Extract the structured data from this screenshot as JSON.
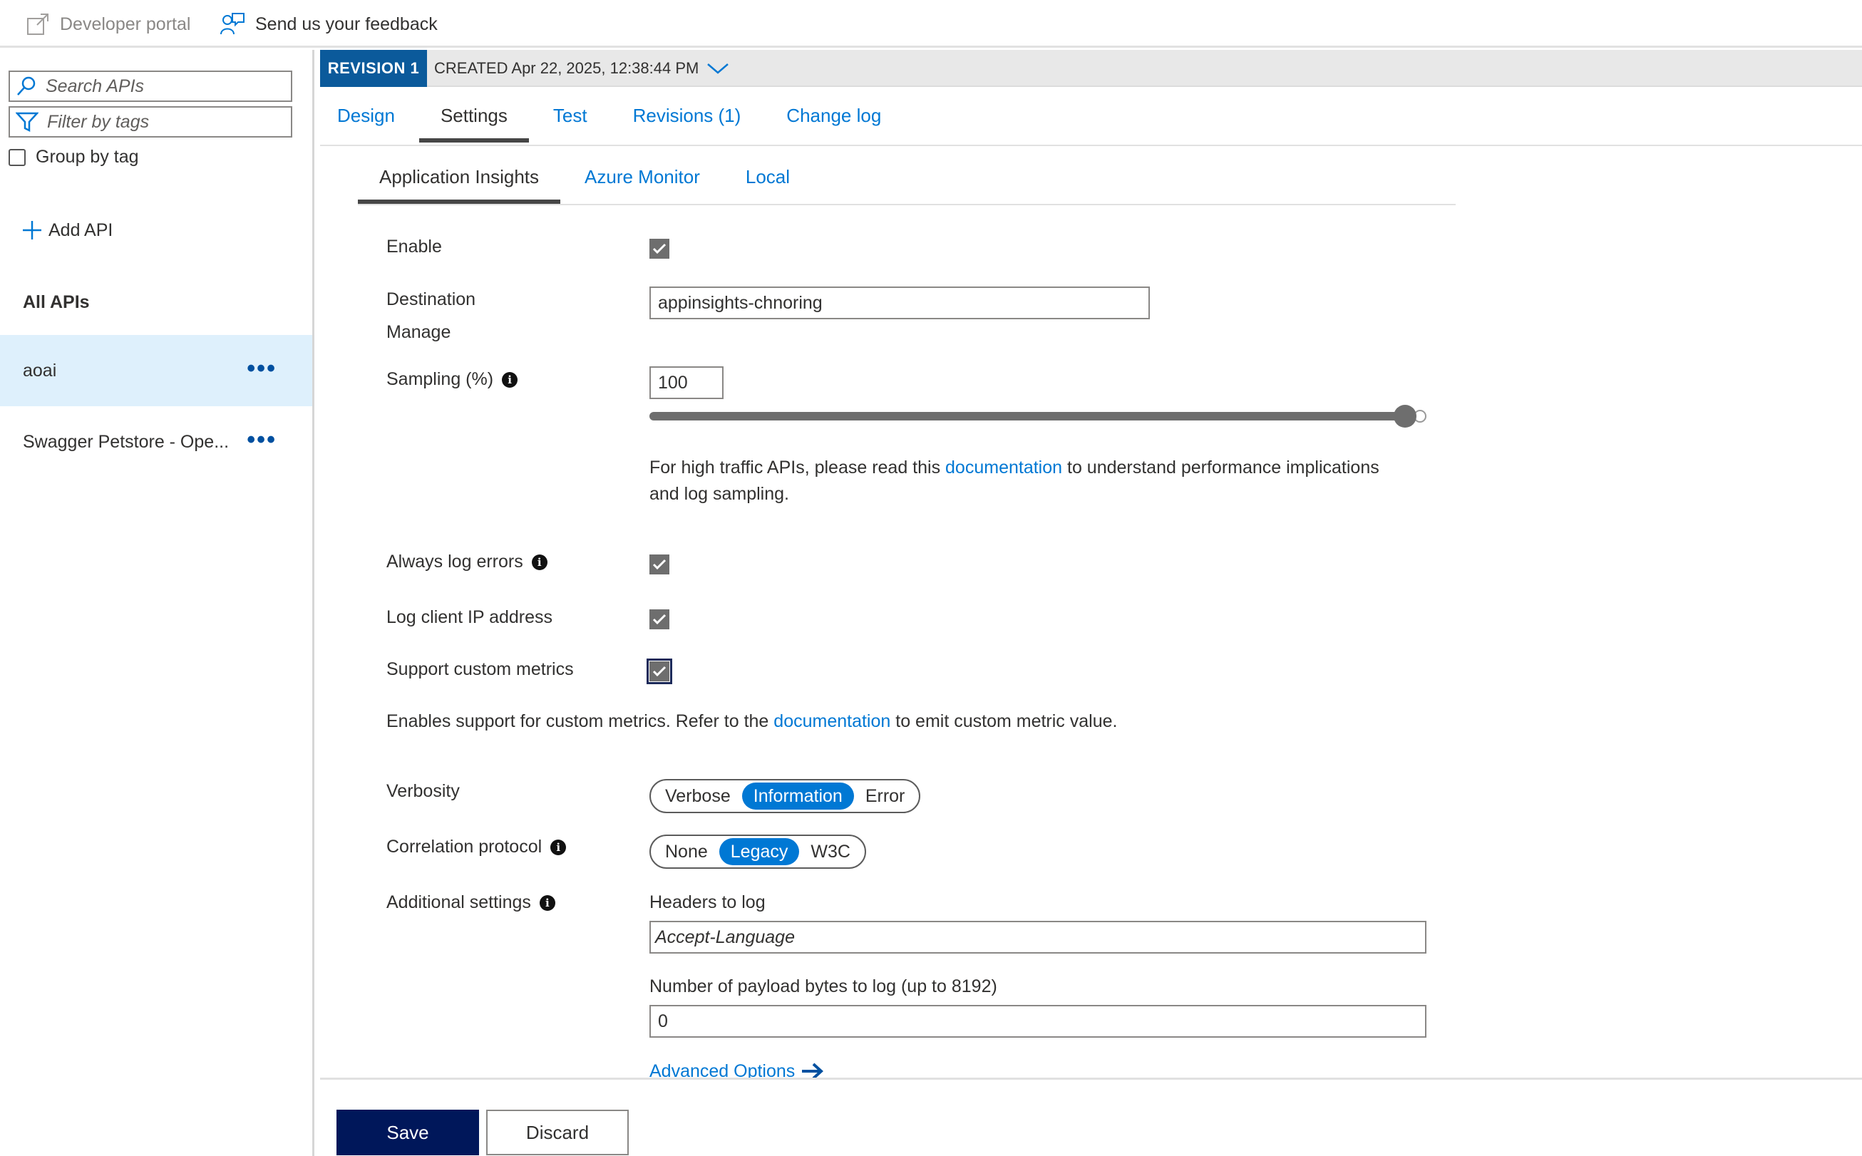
{
  "topbar": {
    "developer_portal": "Developer portal",
    "feedback": "Send us your feedback"
  },
  "sidebar": {
    "search_placeholder": "Search APIs",
    "filter_placeholder": "Filter by tags",
    "group_by_tag": "Group by tag",
    "add_api": "Add API",
    "all_apis": "All APIs",
    "apis": [
      {
        "name": "aoai",
        "selected": true
      },
      {
        "name": "Swagger Petstore - Ope...",
        "selected": false
      }
    ]
  },
  "revision": {
    "badge": "REVISION 1",
    "created": "CREATED Apr 22, 2025, 12:38:44 PM"
  },
  "tabs": [
    {
      "label": "Design",
      "active": false
    },
    {
      "label": "Settings",
      "active": true
    },
    {
      "label": "Test",
      "active": false
    },
    {
      "label": "Revisions (1)",
      "active": false
    },
    {
      "label": "Change log",
      "active": false
    }
  ],
  "subtabs": [
    {
      "label": "Application Insights",
      "active": true
    },
    {
      "label": "Azure Monitor",
      "active": false
    },
    {
      "label": "Local",
      "active": false
    }
  ],
  "form": {
    "enable_label": "Enable",
    "enable_checked": true,
    "destination_label": "Destination",
    "destination_value": "appinsights-chnoring",
    "manage_link": "Manage",
    "sampling_label": "Sampling (%)",
    "sampling_value": "100",
    "sampling_percent": 100,
    "traffic_note_pre": "For high traffic APIs, please read this ",
    "traffic_note_link": "documentation",
    "traffic_note_post": " to understand performance implications",
    "traffic_note_line2": "and log sampling.",
    "always_log_errors_label": "Always log errors",
    "always_log_errors_checked": true,
    "log_client_ip_label": "Log client IP address",
    "log_client_ip_checked": true,
    "custom_metrics_label": "Support custom metrics",
    "custom_metrics_checked": true,
    "custom_metrics_note_pre": "Enables support for custom metrics. Refer to the ",
    "custom_metrics_note_link": "documentation",
    "custom_metrics_note_post": " to emit custom metric value.",
    "verbosity_label": "Verbosity",
    "verbosity_options": [
      "Verbose",
      "Information",
      "Error"
    ],
    "verbosity_selected": "Information",
    "correlation_label": "Correlation protocol",
    "correlation_options": [
      "None",
      "Legacy",
      "W3C"
    ],
    "correlation_selected": "Legacy",
    "additional_label": "Additional settings",
    "headers_label": "Headers to log",
    "headers_value": "Accept-Language",
    "payload_label": "Number of payload bytes to log (up to 8192)",
    "payload_value": "0",
    "advanced_options": "Advanced Options"
  },
  "footer": {
    "save": "Save",
    "discard": "Discard"
  },
  "colors": {
    "accent": "#0078d4",
    "save_button": "#00175a",
    "revision_badge": "#0b5a9b",
    "selected_row": "#def0fc"
  }
}
